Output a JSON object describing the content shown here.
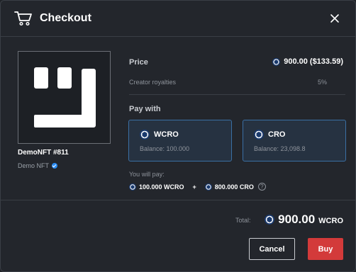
{
  "header": {
    "title": "Checkout"
  },
  "nft": {
    "name": "DemoNFT #811",
    "collection": "Demo NFT"
  },
  "price": {
    "label": "Price",
    "value": "900.00 ($133.59)"
  },
  "royalties": {
    "label": "Creator royalties",
    "value": "5%"
  },
  "pay_with": {
    "label": "Pay with",
    "options": [
      {
        "name": "WCRO",
        "balance": "Balance: 100.000"
      },
      {
        "name": "CRO",
        "balance": "Balance: 23,098.8"
      }
    ]
  },
  "you_will_pay": {
    "label": "You will pay:",
    "wcro_amount": "100.000 WCRO",
    "plus": "+",
    "cro_amount": "800.000 CRO",
    "help": "?"
  },
  "total": {
    "label": "Total:",
    "amount": "900.00",
    "unit": "WCRO"
  },
  "actions": {
    "cancel": "Cancel",
    "buy": "Buy"
  },
  "colors": {
    "accent": "#3a6fa4",
    "buy": "#d33a3a",
    "background": "#23262c"
  }
}
